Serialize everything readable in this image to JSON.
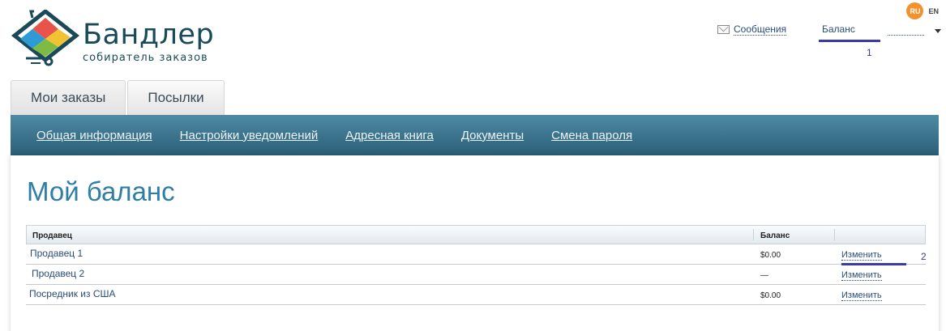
{
  "brand": {
    "name": "Бандлер",
    "tagline": "собиратель заказов"
  },
  "languages": {
    "ru": "RU",
    "en": "EN",
    "active": "RU"
  },
  "header": {
    "messages_label": "Сообщения",
    "balance_label": "Баланс",
    "annotation_1": "1"
  },
  "tabs": [
    {
      "label": "Мои заказы",
      "active": true
    },
    {
      "label": "Посылки",
      "active": false
    }
  ],
  "subnav": [
    {
      "label": "Общая информация"
    },
    {
      "label": "Настройки уведомлений"
    },
    {
      "label": "Адресная книга"
    },
    {
      "label": "Документы"
    },
    {
      "label": "Смена пароля"
    }
  ],
  "page": {
    "title": "Мой баланс"
  },
  "table": {
    "columns": [
      "Продавец",
      "Баланс",
      ""
    ],
    "rows": [
      {
        "seller": "Продавец 1",
        "balance": "$0.00",
        "action": "Изменить"
      },
      {
        "seller": "Продавец 2",
        "balance": "—",
        "action": "Изменить"
      },
      {
        "seller": "Посредник из США",
        "balance": "$0.00",
        "action": "Изменить"
      }
    ],
    "annotation_2": "2"
  },
  "colors": {
    "accent_orange": "#f3922c",
    "nav_bar": "#2b5f78",
    "title_blue": "#2f7ea6",
    "link_blue": "#2a4c7a",
    "annotation_blue": "#3a3aa8"
  }
}
